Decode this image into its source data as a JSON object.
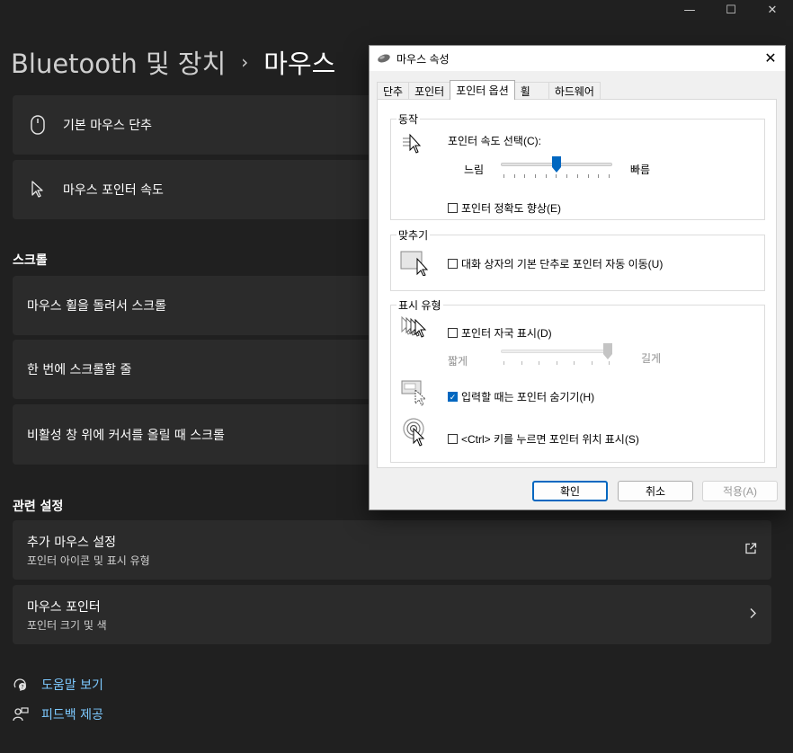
{
  "window": {
    "minimize": "—",
    "maximize": "☐",
    "close": "✕"
  },
  "breadcrumb": {
    "parent": "Bluetooth 및 장치",
    "separator": "›",
    "current": "마우스"
  },
  "cards": {
    "primary_button": "기본 마우스 단추",
    "pointer_speed": "마우스 포인터 속도"
  },
  "scroll": {
    "heading": "스크롤",
    "wheel": "마우스 휠을 돌려서 스크롤",
    "lines": "한 번에 스크롤할 줄",
    "inactive": "비활성 창 위에 커서를 올릴 때 스크롤"
  },
  "related": {
    "heading": "관련 설정",
    "additional": {
      "title": "추가 마우스 설정",
      "subtitle": "포인터 아이콘 및 표시 유형"
    },
    "pointer": {
      "title": "마우스 포인터",
      "subtitle": "포인터 크기 및 색"
    }
  },
  "links": {
    "help": "도움말 보기",
    "feedback": "피드백 제공"
  },
  "dialog": {
    "title": "마우스 속성",
    "tabs": [
      "단추",
      "포인터",
      "포인터 옵션",
      "휠",
      "하드웨어"
    ],
    "active_tab": "포인터 옵션",
    "motion": {
      "legend": "동작",
      "speed_label": "포인터 속도 선택(C):",
      "slow": "느림",
      "fast": "빠름",
      "speed_level": 0.5,
      "precision": {
        "label": "포인터 정확도 향상(E)",
        "checked": false
      }
    },
    "snap": {
      "legend": "맞추기",
      "label": "대화 상자의 기본 단추로 포인터 자동 이동(U)",
      "checked": false
    },
    "visibility": {
      "legend": "표시 유형",
      "trails": {
        "label": "포인터 자국 표시(D)",
        "checked": false
      },
      "short": "짧게",
      "long": "길게",
      "trail_level": 1.0,
      "hide": {
        "label": "입력할 때는 포인터 숨기기(H)",
        "checked": true
      },
      "ctrl": {
        "label": "<Ctrl> 키를 누르면 포인터 위치 표시(S)",
        "checked": false
      }
    },
    "buttons": {
      "ok": "확인",
      "cancel": "취소",
      "apply": "적용(A)"
    }
  },
  "colors": {
    "background": "#202020",
    "card": "#2b2b2b",
    "link": "#7dc9ff",
    "accent": "#0067c0"
  }
}
